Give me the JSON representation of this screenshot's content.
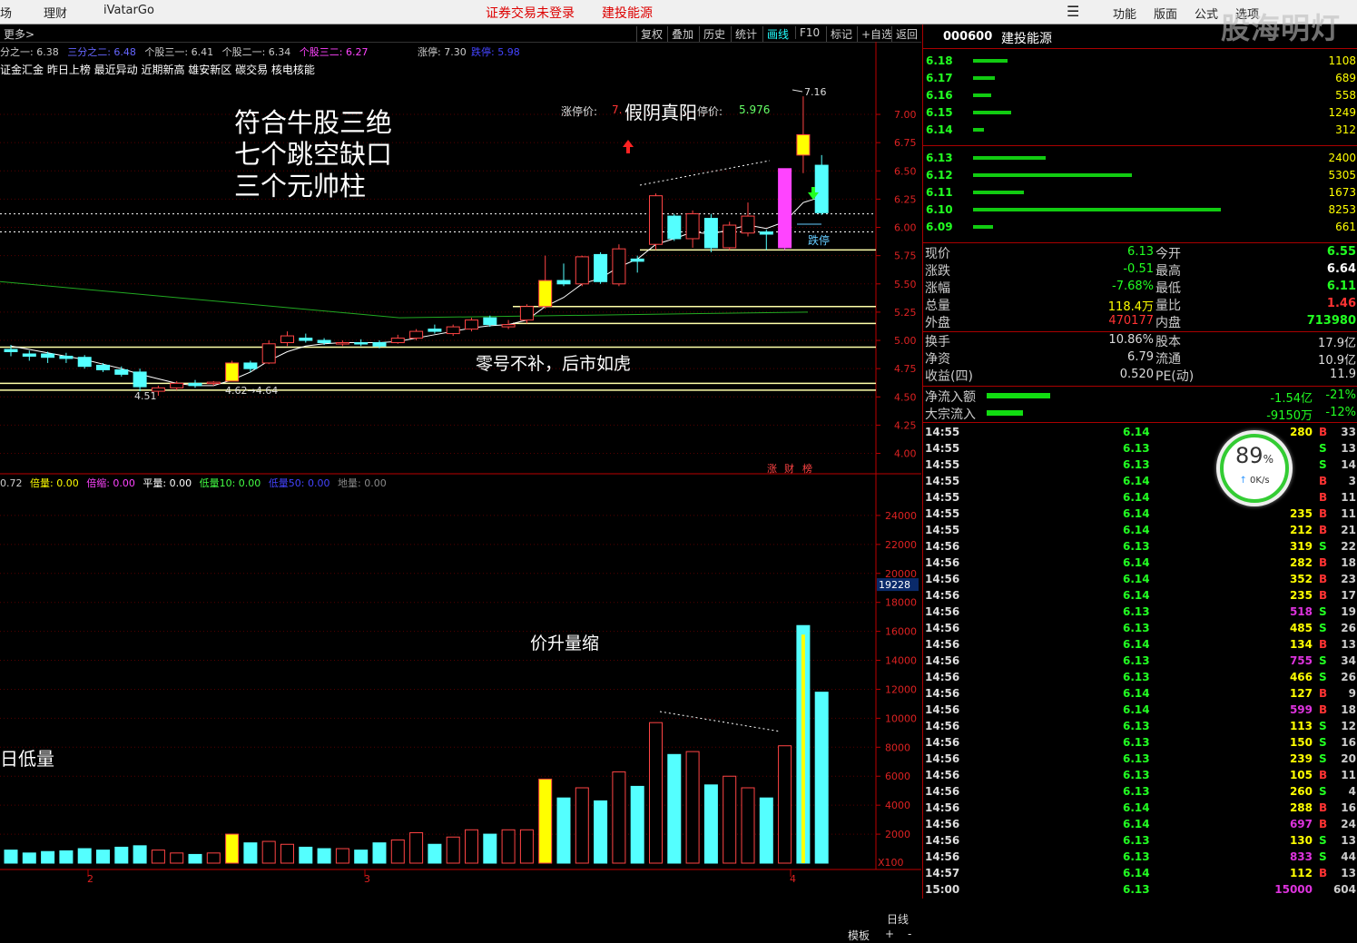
{
  "topbar": {
    "menus": [
      "场",
      "理财",
      "iVatarGo"
    ],
    "warning": "证券交易未登录",
    "stock_name": "建投能源",
    "right_menus": [
      "功能",
      "版面",
      "公式",
      "选项"
    ],
    "watermark": "股海明灯"
  },
  "toolbar": {
    "more": "更多>",
    "buttons": [
      "复权",
      "叠加",
      "历史",
      "统计",
      "画线",
      "F10",
      "标记",
      "+自选",
      "返回"
    ],
    "active": "画线"
  },
  "indicators": {
    "line1": [
      {
        "text": "分之一: 6.38",
        "color": "#cccccc"
      },
      {
        "text": "三分之二: 6.48",
        "color": "#6666ff"
      },
      {
        "text": "个股三一: 6.41",
        "color": "#cccccc"
      },
      {
        "text": "个股二一: 6.34",
        "color": "#cccccc"
      },
      {
        "text": "个股三二: 6.27",
        "color": "#ff44ff"
      }
    ],
    "limit_up": "涨停: 7.30",
    "limit_down": "跌停: 5.98",
    "line2": "证金汇金 昨日上榜 最近异动 近期新高 雄安新区 碳交易 核电核能"
  },
  "chart_data": {
    "type": "candlestick",
    "title": "",
    "price_axis": {
      "ticks": [
        7.0,
        6.75,
        6.5,
        6.25,
        6.0,
        5.75,
        5.5,
        5.25,
        5.0,
        4.75,
        4.5,
        4.25,
        4.0
      ],
      "ylim": [
        3.9,
        7.45
      ]
    },
    "volume_axis": {
      "ticks": [
        24000,
        22000,
        20000,
        18000,
        16000,
        14000,
        12000,
        10000,
        8000,
        6000,
        4000,
        2000
      ],
      "ylim": [
        0,
        26000
      ],
      "current": "19228",
      "unit": "X100"
    },
    "x_labels": [
      "2",
      "3",
      "4"
    ],
    "candles": [
      {
        "o": 4.92,
        "h": 4.96,
        "l": 4.86,
        "c": 4.9,
        "v": 900
      },
      {
        "o": 4.88,
        "h": 4.91,
        "l": 4.82,
        "c": 4.86,
        "v": 700
      },
      {
        "o": 4.88,
        "h": 4.9,
        "l": 4.8,
        "c": 4.85,
        "v": 800
      },
      {
        "o": 4.86,
        "h": 4.89,
        "l": 4.8,
        "c": 4.84,
        "v": 850
      },
      {
        "o": 4.85,
        "h": 4.87,
        "l": 4.75,
        "c": 4.77,
        "v": 1000
      },
      {
        "o": 4.78,
        "h": 4.8,
        "l": 4.72,
        "c": 4.74,
        "v": 900
      },
      {
        "o": 4.74,
        "h": 4.77,
        "l": 4.68,
        "c": 4.7,
        "v": 1100
      },
      {
        "o": 4.72,
        "h": 4.75,
        "l": 4.55,
        "c": 4.59,
        "v": 1200
      },
      {
        "o": 4.55,
        "h": 4.6,
        "l": 4.51,
        "c": 4.58,
        "v": 900
      },
      {
        "o": 4.58,
        "h": 4.64,
        "l": 4.56,
        "c": 4.62,
        "v": 700
      },
      {
        "o": 4.62,
        "h": 4.65,
        "l": 4.58,
        "c": 4.6,
        "v": 600
      },
      {
        "o": 4.62,
        "h": 4.64,
        "l": 4.6,
        "c": 4.63,
        "v": 700
      },
      {
        "o": 4.64,
        "h": 4.82,
        "l": 4.64,
        "c": 4.8,
        "v": 2000
      },
      {
        "o": 4.8,
        "h": 4.82,
        "l": 4.72,
        "c": 4.75,
        "v": 1400
      },
      {
        "o": 4.8,
        "h": 5.0,
        "l": 4.79,
        "c": 4.97,
        "v": 1500
      },
      {
        "o": 4.98,
        "h": 5.08,
        "l": 4.95,
        "c": 5.04,
        "v": 1300
      },
      {
        "o": 5.02,
        "h": 5.06,
        "l": 4.98,
        "c": 5.0,
        "v": 1100
      },
      {
        "o": 5.0,
        "h": 5.02,
        "l": 4.96,
        "c": 4.98,
        "v": 1000
      },
      {
        "o": 4.97,
        "h": 5.0,
        "l": 4.95,
        "c": 4.98,
        "v": 1000
      },
      {
        "o": 4.98,
        "h": 5.01,
        "l": 4.95,
        "c": 4.97,
        "v": 900
      },
      {
        "o": 4.98,
        "h": 5.0,
        "l": 4.93,
        "c": 4.95,
        "v": 1400
      },
      {
        "o": 4.98,
        "h": 5.05,
        "l": 4.97,
        "c": 5.02,
        "v": 1600
      },
      {
        "o": 5.02,
        "h": 5.1,
        "l": 5.0,
        "c": 5.08,
        "v": 2100
      },
      {
        "o": 5.1,
        "h": 5.14,
        "l": 5.06,
        "c": 5.08,
        "v": 1300
      },
      {
        "o": 5.06,
        "h": 5.14,
        "l": 5.04,
        "c": 5.12,
        "v": 1800
      },
      {
        "o": 5.1,
        "h": 5.2,
        "l": 5.08,
        "c": 5.18,
        "v": 2300
      },
      {
        "o": 5.2,
        "h": 5.22,
        "l": 5.12,
        "c": 5.14,
        "v": 2000
      },
      {
        "o": 5.12,
        "h": 5.18,
        "l": 5.1,
        "c": 5.14,
        "v": 2300
      },
      {
        "o": 5.18,
        "h": 5.32,
        "l": 5.15,
        "c": 5.3,
        "v": 2300
      },
      {
        "o": 5.3,
        "h": 5.75,
        "l": 5.28,
        "c": 5.53,
        "v": 5800
      },
      {
        "o": 5.53,
        "h": 5.68,
        "l": 5.48,
        "c": 5.5,
        "v": 4500
      },
      {
        "o": 5.5,
        "h": 5.75,
        "l": 5.48,
        "c": 5.74,
        "v": 5200
      },
      {
        "o": 5.76,
        "h": 5.78,
        "l": 5.5,
        "c": 5.52,
        "v": 4300
      },
      {
        "o": 5.5,
        "h": 5.85,
        "l": 5.48,
        "c": 5.81,
        "v": 6300
      },
      {
        "o": 5.72,
        "h": 5.75,
        "l": 5.6,
        "c": 5.7,
        "v": 5300
      },
      {
        "o": 5.85,
        "h": 6.3,
        "l": 5.8,
        "c": 6.28,
        "v": 9700
      },
      {
        "o": 6.1,
        "h": 6.12,
        "l": 5.88,
        "c": 5.9,
        "v": 7500
      },
      {
        "o": 5.9,
        "h": 6.15,
        "l": 5.82,
        "c": 6.12,
        "v": 7700
      },
      {
        "o": 6.08,
        "h": 6.12,
        "l": 5.78,
        "c": 5.82,
        "v": 5400
      },
      {
        "o": 5.82,
        "h": 6.05,
        "l": 5.8,
        "c": 6.02,
        "v": 6000
      },
      {
        "o": 5.95,
        "h": 6.22,
        "l": 5.92,
        "c": 6.1,
        "v": 5200
      },
      {
        "o": 5.96,
        "h": 5.98,
        "l": 5.8,
        "c": 5.94,
        "v": 4500
      },
      {
        "o": 5.82,
        "h": 6.52,
        "l": 5.8,
        "c": 6.52,
        "v": 8100
      },
      {
        "o": 6.82,
        "h": 7.16,
        "l": 6.48,
        "c": 6.64,
        "v": 16400
      },
      {
        "o": 6.55,
        "h": 6.64,
        "l": 6.11,
        "c": 6.13,
        "v": 11800
      }
    ],
    "ma": [
      4.95,
      4.92,
      4.89,
      4.86,
      4.83,
      4.79,
      4.75,
      4.7,
      4.66,
      4.62,
      4.6,
      4.6,
      4.65,
      4.72,
      4.82,
      4.9,
      4.95,
      4.97,
      4.98,
      4.98,
      4.98,
      4.99,
      5.02,
      5.05,
      5.08,
      5.11,
      5.13,
      5.14,
      5.18,
      5.3,
      5.38,
      5.5,
      5.55,
      5.65,
      5.72,
      5.85,
      5.9,
      5.96,
      5.94,
      5.98,
      6.02,
      5.99,
      6.05,
      6.22,
      6.27
    ],
    "ma_long": {
      "start": 5.52,
      "end": 5.2
    },
    "support_lines": [
      5.8,
      5.3,
      5.15,
      4.94,
      4.62,
      4.56
    ],
    "candle_labels": {
      "high": "7.16",
      "low": "4.51",
      "gap": "4.62→4.64"
    }
  },
  "annotations": {
    "main_note": [
      "符合牛股三绝",
      "七个跳空缺口",
      "三个元帅柱"
    ],
    "limit_text": "涨停价:",
    "limit_val": "7.",
    "fake_yin": "假阴真阳",
    "stop_text": "停价:",
    "stop_val": "5.976",
    "limit_down_label": "跌停",
    "zero_note": "零号不补，后市如虎",
    "vol_note": "价升量缩",
    "low_vol_note": "日低量",
    "badges": [
      "涨",
      "财",
      "榜"
    ]
  },
  "vol_indicators": [
    {
      "text": "0.72",
      "color": "#cccccc"
    },
    {
      "text": "倍量: 0.00",
      "color": "#ffff00"
    },
    {
      "text": "倍缩: 0.00",
      "color": "#ff44ff"
    },
    {
      "text": "平量: 0.00",
      "color": "#ffffff"
    },
    {
      "text": "低量10: 0.00",
      "color": "#44ff44"
    },
    {
      "text": "低量50: 0.00",
      "color": "#4444ff"
    },
    {
      "text": "地量: 0.00",
      "color": "#888888"
    }
  ],
  "bottombar": {
    "daily": "日线",
    "template": "模板",
    "plus": "+",
    "minus": "-"
  },
  "right_panel": {
    "code": "000600",
    "name": "建投能源",
    "sell_orders": [
      {
        "price": "6.18",
        "vol": "1108",
        "bar": 38
      },
      {
        "price": "6.17",
        "vol": "689",
        "bar": 24
      },
      {
        "price": "6.16",
        "vol": "558",
        "bar": 20
      },
      {
        "price": "6.15",
        "vol": "1249",
        "bar": 42
      },
      {
        "price": "6.14",
        "vol": "312",
        "bar": 12
      }
    ],
    "buy_orders": [
      {
        "price": "6.13",
        "vol": "2400",
        "bar": 80
      },
      {
        "price": "6.12",
        "vol": "5305",
        "bar": 175
      },
      {
        "price": "6.11",
        "vol": "1673",
        "bar": 56
      },
      {
        "price": "6.10",
        "vol": "8253",
        "bar": 273
      },
      {
        "price": "6.09",
        "vol": "661",
        "bar": 22
      }
    ],
    "quote": [
      {
        "k1": "现价",
        "v1": "6.13",
        "c1": "#2f2",
        "k2": "今开",
        "v2": "6.55",
        "c2": "#2f2"
      },
      {
        "k1": "涨跌",
        "v1": "-0.51",
        "c1": "#2f2",
        "k2": "最高",
        "v2": "6.64",
        "c2": "#fff"
      },
      {
        "k1": "涨幅",
        "v1": "-7.68%",
        "c1": "#2f2",
        "k2": "最低",
        "v2": "6.11",
        "c2": "#2f2"
      },
      {
        "k1": "总量",
        "v1": "118.4万",
        "c1": "#ff0",
        "k2": "量比",
        "v2": "1.46",
        "c2": "#f33"
      },
      {
        "k1": "外盘",
        "v1": "470177",
        "c1": "#f33",
        "k2": "内盘",
        "v2": "713980",
        "c2": "#2f2"
      }
    ],
    "fundamentals": [
      {
        "k1": "换手",
        "v1": "10.86%",
        "c1": "#ddd",
        "k2": "股本",
        "v2": "17.9亿",
        "c2": "#ddd"
      },
      {
        "k1": "净资",
        "v1": "6.79",
        "c1": "#ddd",
        "k2": "流通",
        "v2": "10.9亿",
        "c2": "#ddd"
      },
      {
        "k1": "收益(四)",
        "v1": "0.520",
        "c1": "#ddd",
        "k2": "PE(动)",
        "v2": "11.9",
        "c2": "#ddd"
      }
    ],
    "flows": [
      {
        "k": "净流入额",
        "v": "-1.54亿",
        "p": "-21%",
        "bar": 70
      },
      {
        "k": "大宗流入",
        "v": "-9150万",
        "p": "-12%",
        "bar": 40
      }
    ],
    "ticks": [
      {
        "t": "14:55",
        "p": "6.14",
        "v": "280",
        "vc": "#ff0",
        "s": "B",
        "sc": "#f33",
        "n": "33"
      },
      {
        "t": "14:55",
        "p": "6.13",
        "v": "",
        "vc": "#ff0",
        "s": "S",
        "sc": "#2f2",
        "n": "13"
      },
      {
        "t": "14:55",
        "p": "6.13",
        "v": "",
        "vc": "#ff0",
        "s": "S",
        "sc": "#2f2",
        "n": "14"
      },
      {
        "t": "14:55",
        "p": "6.14",
        "v": "",
        "vc": "#ff0",
        "s": "B",
        "sc": "#f33",
        "n": "3"
      },
      {
        "t": "14:55",
        "p": "6.14",
        "v": "",
        "vc": "#ff0",
        "s": "B",
        "sc": "#f33",
        "n": "11"
      },
      {
        "t": "14:55",
        "p": "6.14",
        "v": "235",
        "vc": "#ff0",
        "s": "B",
        "sc": "#f33",
        "n": "11"
      },
      {
        "t": "14:55",
        "p": "6.14",
        "v": "212",
        "vc": "#ff0",
        "s": "B",
        "sc": "#f33",
        "n": "21"
      },
      {
        "t": "14:56",
        "p": "6.13",
        "v": "319",
        "vc": "#ff0",
        "s": "S",
        "sc": "#2f2",
        "n": "22"
      },
      {
        "t": "14:56",
        "p": "6.14",
        "v": "282",
        "vc": "#ff0",
        "s": "B",
        "sc": "#f33",
        "n": "18"
      },
      {
        "t": "14:56",
        "p": "6.14",
        "v": "352",
        "vc": "#ff0",
        "s": "B",
        "sc": "#f33",
        "n": "23"
      },
      {
        "t": "14:56",
        "p": "6.14",
        "v": "235",
        "vc": "#ff0",
        "s": "B",
        "sc": "#f33",
        "n": "17"
      },
      {
        "t": "14:56",
        "p": "6.13",
        "v": "518",
        "vc": "#d3d",
        "s": "S",
        "sc": "#2f2",
        "n": "19"
      },
      {
        "t": "14:56",
        "p": "6.13",
        "v": "485",
        "vc": "#ff0",
        "s": "S",
        "sc": "#2f2",
        "n": "26"
      },
      {
        "t": "14:56",
        "p": "6.14",
        "v": "134",
        "vc": "#ff0",
        "s": "B",
        "sc": "#f33",
        "n": "13"
      },
      {
        "t": "14:56",
        "p": "6.13",
        "v": "755",
        "vc": "#d3d",
        "s": "S",
        "sc": "#2f2",
        "n": "34"
      },
      {
        "t": "14:56",
        "p": "6.13",
        "v": "466",
        "vc": "#ff0",
        "s": "S",
        "sc": "#2f2",
        "n": "26"
      },
      {
        "t": "14:56",
        "p": "6.14",
        "v": "127",
        "vc": "#ff0",
        "s": "B",
        "sc": "#f33",
        "n": "9"
      },
      {
        "t": "14:56",
        "p": "6.14",
        "v": "599",
        "vc": "#d3d",
        "s": "B",
        "sc": "#f33",
        "n": "18"
      },
      {
        "t": "14:56",
        "p": "6.13",
        "v": "113",
        "vc": "#ff0",
        "s": "S",
        "sc": "#2f2",
        "n": "12"
      },
      {
        "t": "14:56",
        "p": "6.13",
        "v": "150",
        "vc": "#ff0",
        "s": "S",
        "sc": "#2f2",
        "n": "16"
      },
      {
        "t": "14:56",
        "p": "6.13",
        "v": "239",
        "vc": "#ff0",
        "s": "S",
        "sc": "#2f2",
        "n": "20"
      },
      {
        "t": "14:56",
        "p": "6.13",
        "v": "105",
        "vc": "#ff0",
        "s": "B",
        "sc": "#f33",
        "n": "11"
      },
      {
        "t": "14:56",
        "p": "6.13",
        "v": "260",
        "vc": "#ff0",
        "s": "S",
        "sc": "#2f2",
        "n": "4"
      },
      {
        "t": "14:56",
        "p": "6.14",
        "v": "288",
        "vc": "#ff0",
        "s": "B",
        "sc": "#f33",
        "n": "16"
      },
      {
        "t": "14:56",
        "p": "6.14",
        "v": "697",
        "vc": "#d3d",
        "s": "B",
        "sc": "#f33",
        "n": "24"
      },
      {
        "t": "14:56",
        "p": "6.13",
        "v": "130",
        "vc": "#ff0",
        "s": "S",
        "sc": "#2f2",
        "n": "13"
      },
      {
        "t": "14:56",
        "p": "6.13",
        "v": "833",
        "vc": "#d3d",
        "s": "S",
        "sc": "#2f2",
        "n": "44"
      },
      {
        "t": "14:57",
        "p": "6.14",
        "v": "112",
        "vc": "#ff0",
        "s": "B",
        "sc": "#f33",
        "n": "13"
      },
      {
        "t": "15:00",
        "p": "6.13",
        "v": "15000",
        "vc": "#d3d",
        "s": "",
        "sc": "#2f2",
        "n": "604"
      }
    ],
    "gauge": {
      "pct": "89",
      "speed": "0K/s"
    }
  }
}
